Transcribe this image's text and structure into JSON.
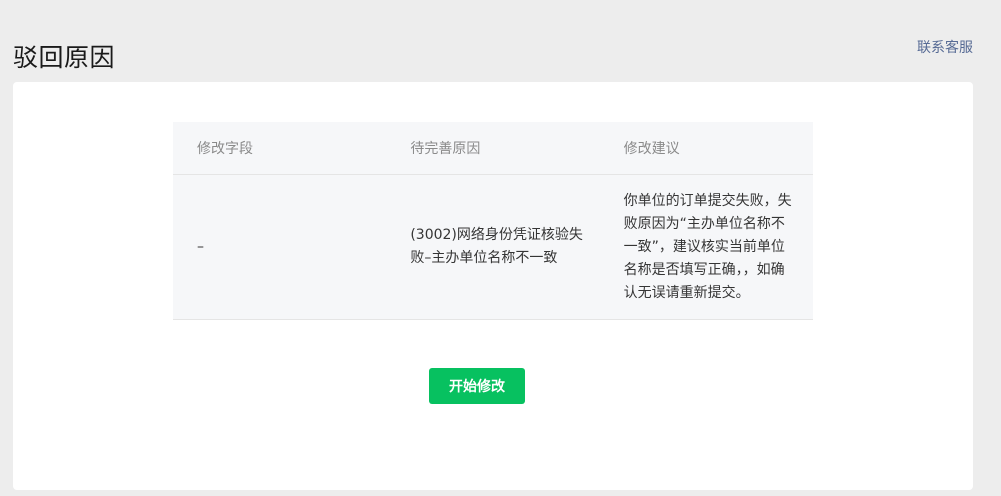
{
  "header": {
    "title": "驳回原因",
    "contact_label": "联系客服"
  },
  "table": {
    "columns": [
      "修改字段",
      "待完善原因",
      "修改建议"
    ],
    "rows": [
      {
        "field": "–",
        "reason": "(3002)网络身份凭证核验失败–主办单位名称不一致",
        "suggestion": "你单位的订单提交失败，失败原因为“主办单位名称不一致”，建议核实当前单位名称是否填写正确，，如确认无误请重新提交。"
      }
    ]
  },
  "actions": {
    "start_label": "开始修改"
  },
  "colors": {
    "accent": "#07c160",
    "link": "#576b95",
    "page_background": "#ededed",
    "table_background": "#f6f7f9"
  }
}
